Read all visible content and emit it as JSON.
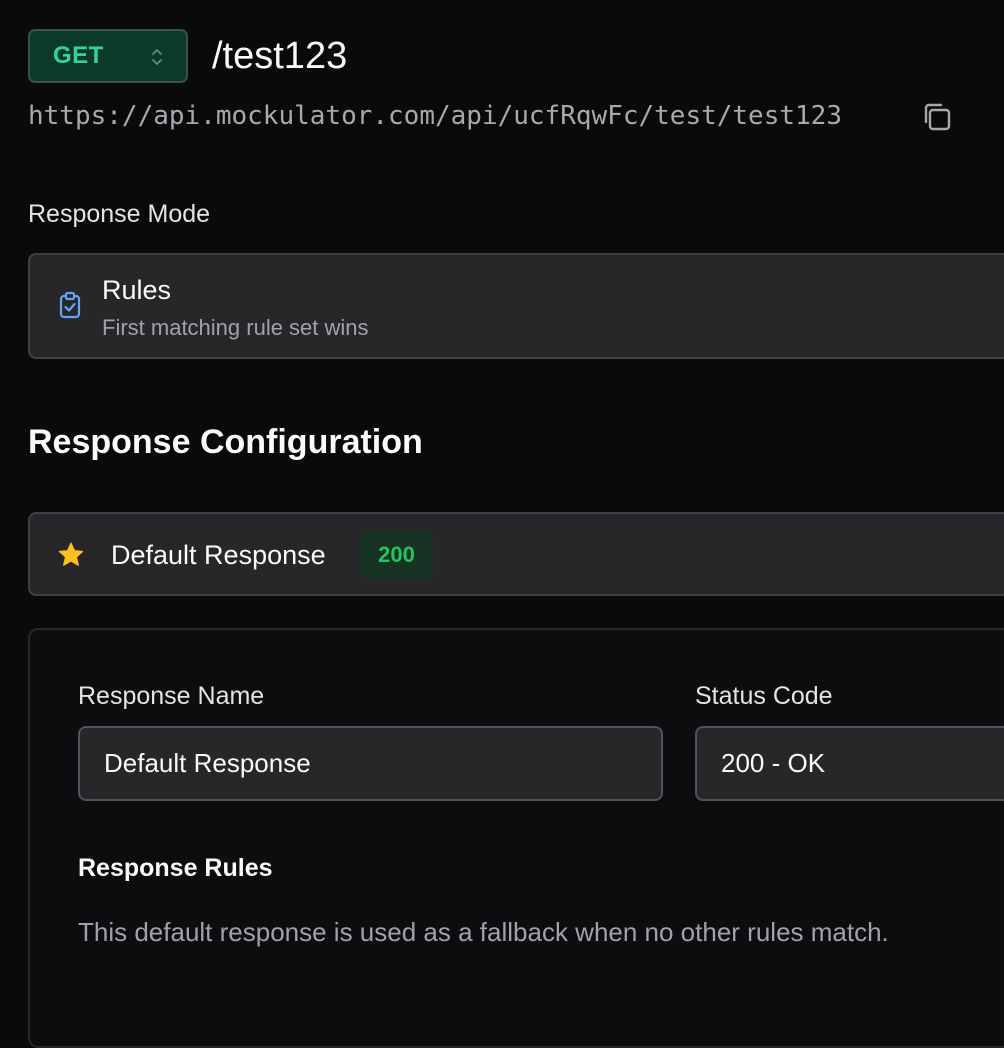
{
  "endpoint": {
    "method": "GET",
    "path": "/test123",
    "url": "https://api.mockulator.com/api/ucfRqwFc/test/test123",
    "method_icon": "chevron-up-down-icon",
    "copy_icon": "copy-icon"
  },
  "response_mode": {
    "label": "Response Mode",
    "selected": {
      "title": "Rules",
      "description": "First matching rule set wins",
      "icon": "clipboard-check-icon"
    }
  },
  "response_configuration": {
    "heading": "Response Configuration",
    "default_response": {
      "title": "Default Response",
      "status": "200",
      "icon": "star-icon"
    },
    "editor": {
      "name_label": "Response Name",
      "name_value": "Default Response",
      "status_label": "Status Code",
      "status_value": "200 - OK",
      "rules_label": "Response Rules",
      "rules_help": "This default response is used as a fallback when no other rules match."
    }
  },
  "colors": {
    "background": "#0a0a0a",
    "method_green": "#34d399",
    "status_green": "#22c55e",
    "star_yellow": "#fbbf24",
    "clipboard_blue": "#60a5fa",
    "card": "#27272a"
  }
}
